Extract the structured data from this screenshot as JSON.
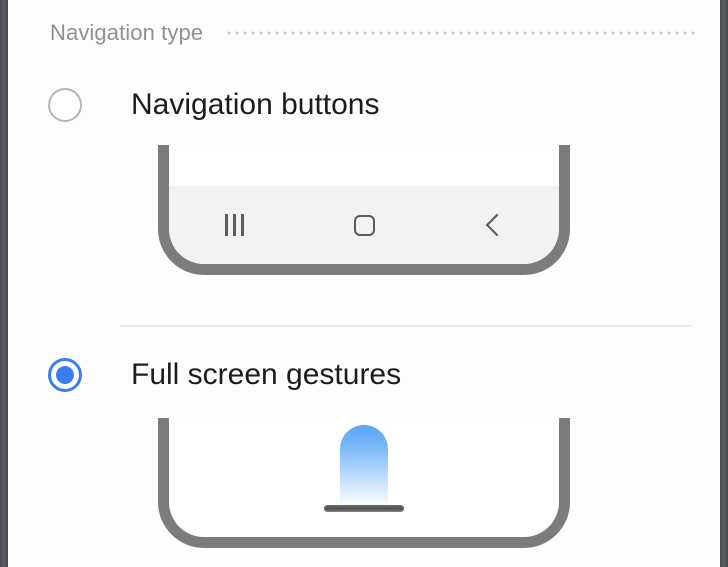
{
  "screen": {
    "background_color": "#fdfdfd",
    "edge_color": "#4a4d52"
  },
  "section": {
    "title": "Navigation type",
    "title_color": "#8f9195",
    "dots_color": "#c3c5c8"
  },
  "divider": {
    "color": "#ececec"
  },
  "options": [
    {
      "id": "navigation-buttons",
      "label": "Navigation buttons",
      "selected": false,
      "radio_color": "#b3b5b9",
      "illustration": {
        "type": "phone-with-navbar",
        "frame_color": "#7c7c7c",
        "navbar_color": "#f2f2f2",
        "icon_color": "#5a5a5a",
        "keys": [
          {
            "name": "recents-icon",
            "glyph": "|||"
          },
          {
            "name": "home-icon",
            "glyph": "▢"
          },
          {
            "name": "back-icon",
            "glyph": "‹"
          }
        ]
      }
    },
    {
      "id": "full-screen-gestures",
      "label": "Full screen gestures",
      "selected": true,
      "radio_color": "#3b7ef0",
      "illustration": {
        "type": "phone-with-gesture",
        "frame_color": "#7c7c7c",
        "swipe_gradient_top": "#59a5f7",
        "swipe_gradient_bottom": "#fbfdff",
        "handle_color": "#4f4f4f"
      }
    }
  ]
}
